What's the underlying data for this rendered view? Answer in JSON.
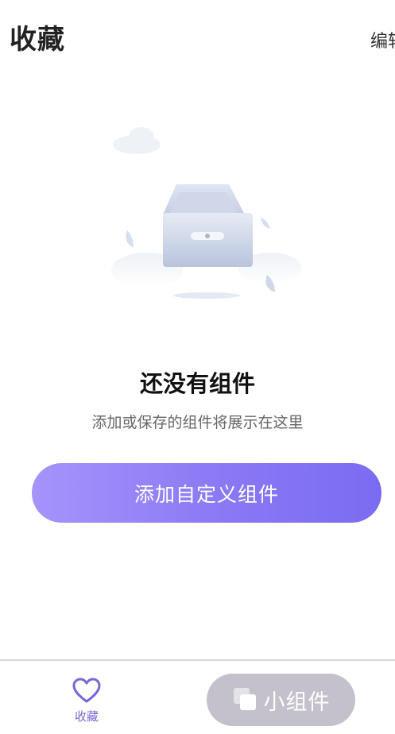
{
  "header": {
    "title": "收藏",
    "edit_label": "编辑"
  },
  "empty_state": {
    "title": "还没有组件",
    "subtitle": "添加或保存的组件将展示在这里"
  },
  "add_button": {
    "label": "添加自定义组件"
  },
  "bottom_nav": {
    "favorites": {
      "label": "收藏",
      "icon": "heart-icon",
      "active": true
    },
    "widget_button": {
      "label": "小组件",
      "icon": "widget-stack-icon"
    }
  },
  "colors": {
    "accent": "#8a78f5",
    "nav_active": "#7a66d6",
    "widget_button_bg": "#c4c1cc"
  }
}
